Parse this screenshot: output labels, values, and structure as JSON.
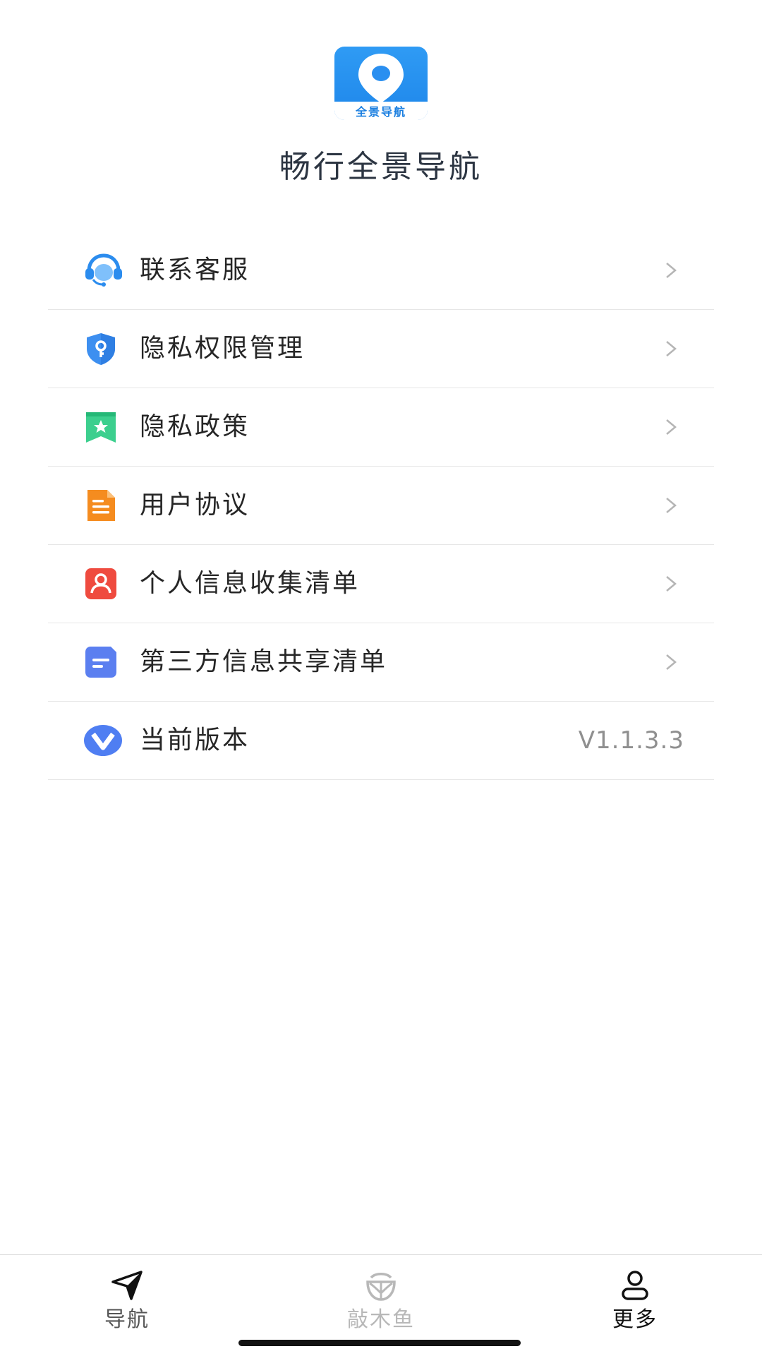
{
  "header": {
    "logo_text": "全景导航",
    "app_name": "畅行全景导航"
  },
  "menu": {
    "items": [
      {
        "label": "联系客服",
        "icon": "headset-icon"
      },
      {
        "label": "隐私权限管理",
        "icon": "shield-key-icon"
      },
      {
        "label": "隐私政策",
        "icon": "bookmark-star-icon"
      },
      {
        "label": "用户协议",
        "icon": "document-icon"
      },
      {
        "label": "个人信息收集清单",
        "icon": "person-card-icon"
      },
      {
        "label": "第三方信息共享清单",
        "icon": "list-card-icon"
      },
      {
        "label": "当前版本",
        "icon": "version-v-icon",
        "value": "V1.1.3.3"
      }
    ]
  },
  "tabs": [
    {
      "label": "导航",
      "icon": "navigation-arrow-icon",
      "active": false
    },
    {
      "label": "敲木鱼",
      "icon": "wooden-fish-icon",
      "active": false
    },
    {
      "label": "更多",
      "icon": "person-icon",
      "active": true
    }
  ],
  "colors": {
    "brand_blue": "#1e86ea",
    "text_primary": "#262626",
    "text_muted": "#8f8f8f",
    "divider": "#e6e6e6"
  }
}
